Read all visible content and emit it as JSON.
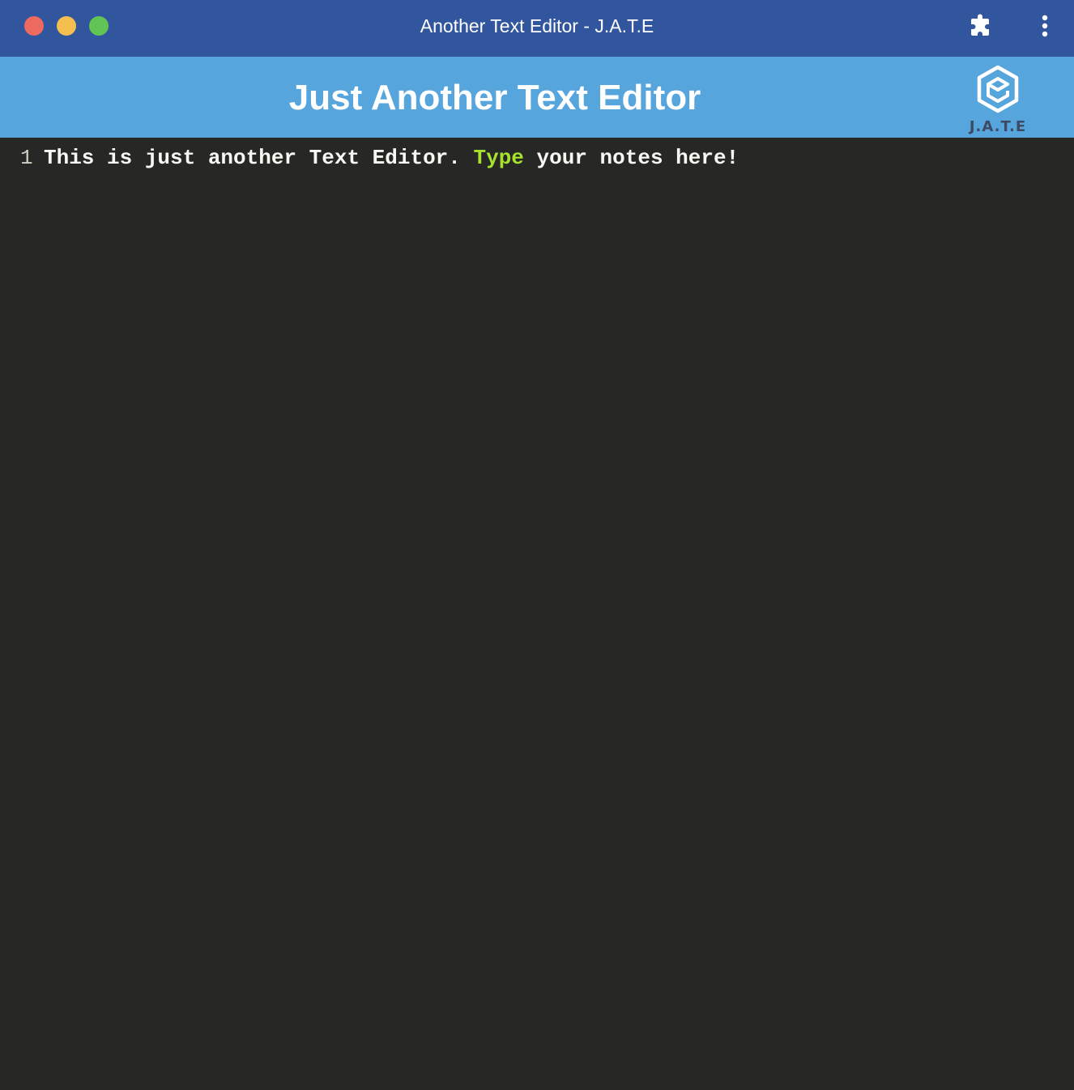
{
  "window": {
    "title": "Another Text Editor - J.A.T.E",
    "controls": [
      "close",
      "minimize",
      "zoom"
    ],
    "toolbar_icons": [
      "puzzle-icon",
      "kebab-menu-icon"
    ]
  },
  "header": {
    "title": "Just Another Text Editor",
    "logo_text": "J.A.T.E",
    "background": "#57a5dd"
  },
  "editor": {
    "lines": [
      {
        "number": "1",
        "segments": {
          "before": "This is just another Text Editor. ",
          "highlight": "Type",
          "after": " your notes here!"
        }
      }
    ],
    "theme": {
      "background": "#272825",
      "text": "#f8f8f2",
      "highlight": "#a6e22e"
    }
  },
  "colors": {
    "titlebar": "#31569e",
    "close": "#ed6a5e",
    "minimize": "#f5bf4f",
    "zoom": "#61c454"
  }
}
